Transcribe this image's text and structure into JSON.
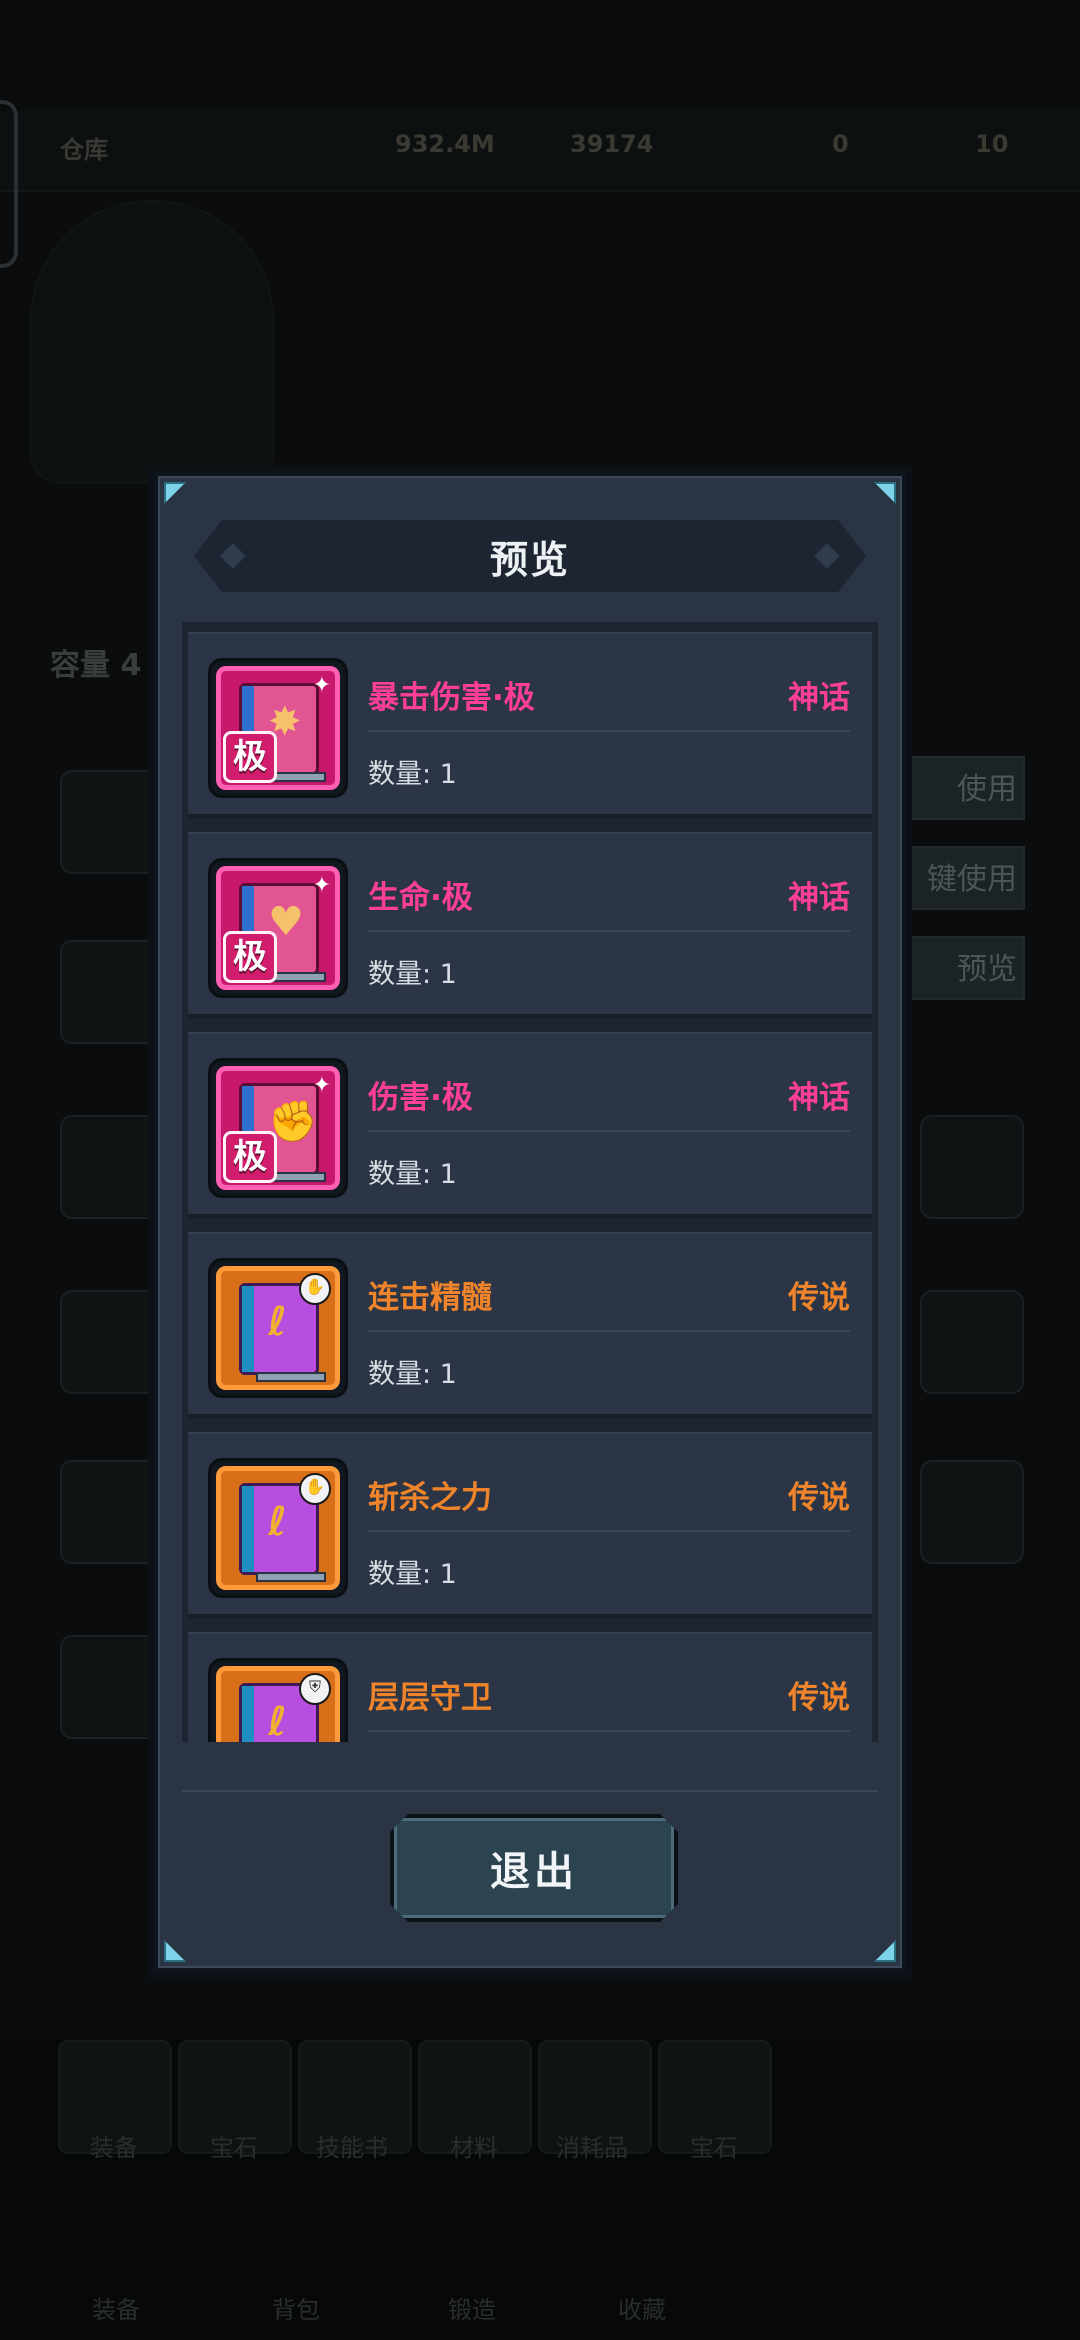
{
  "background": {
    "topbar": {
      "title": "仓库",
      "gold": "932.4M",
      "gems": "39174",
      "res3": "0",
      "res4": "10"
    },
    "capacity_label": "容量 4",
    "side_buttons": [
      "使用",
      "键使用",
      "预览"
    ],
    "bottom_tabs": [
      "装备",
      "宝石",
      "技能书",
      "材料",
      "消耗品",
      "宝石"
    ],
    "bottom_nav": [
      "装备",
      "背包",
      "锻造",
      "收藏"
    ]
  },
  "modal": {
    "title": "预览",
    "exit_label": "退出",
    "items": [
      {
        "name": "暴击伤害·极",
        "rarity": "神话",
        "quantity": "数量: 1",
        "tier": "myth",
        "glyph": "✸",
        "badge": "极"
      },
      {
        "name": "生命·极",
        "rarity": "神话",
        "quantity": "数量: 1",
        "tier": "myth",
        "glyph": "♥",
        "badge": "极"
      },
      {
        "name": "伤害·极",
        "rarity": "神话",
        "quantity": "数量: 1",
        "tier": "myth",
        "glyph": "✊",
        "badge": "极"
      },
      {
        "name": "连击精髓",
        "rarity": "传说",
        "quantity": "数量: 1",
        "tier": "legend",
        "glyph": "ℓ"
      },
      {
        "name": "斩杀之力",
        "rarity": "传说",
        "quantity": "数量: 1",
        "tier": "legend",
        "glyph": "ℓ"
      },
      {
        "name": "层层守卫",
        "rarity": "传说",
        "quantity": "",
        "tier": "legend",
        "glyph": "ℓ"
      }
    ]
  },
  "colors": {
    "myth": "#ff3e96",
    "legend": "#f0842a",
    "panel": "#2a3442"
  },
  "icons": [
    "book-icon",
    "sparkle-icon",
    "fist-icon",
    "heart-icon",
    "starburst-icon",
    "tier-ji-badge"
  ]
}
